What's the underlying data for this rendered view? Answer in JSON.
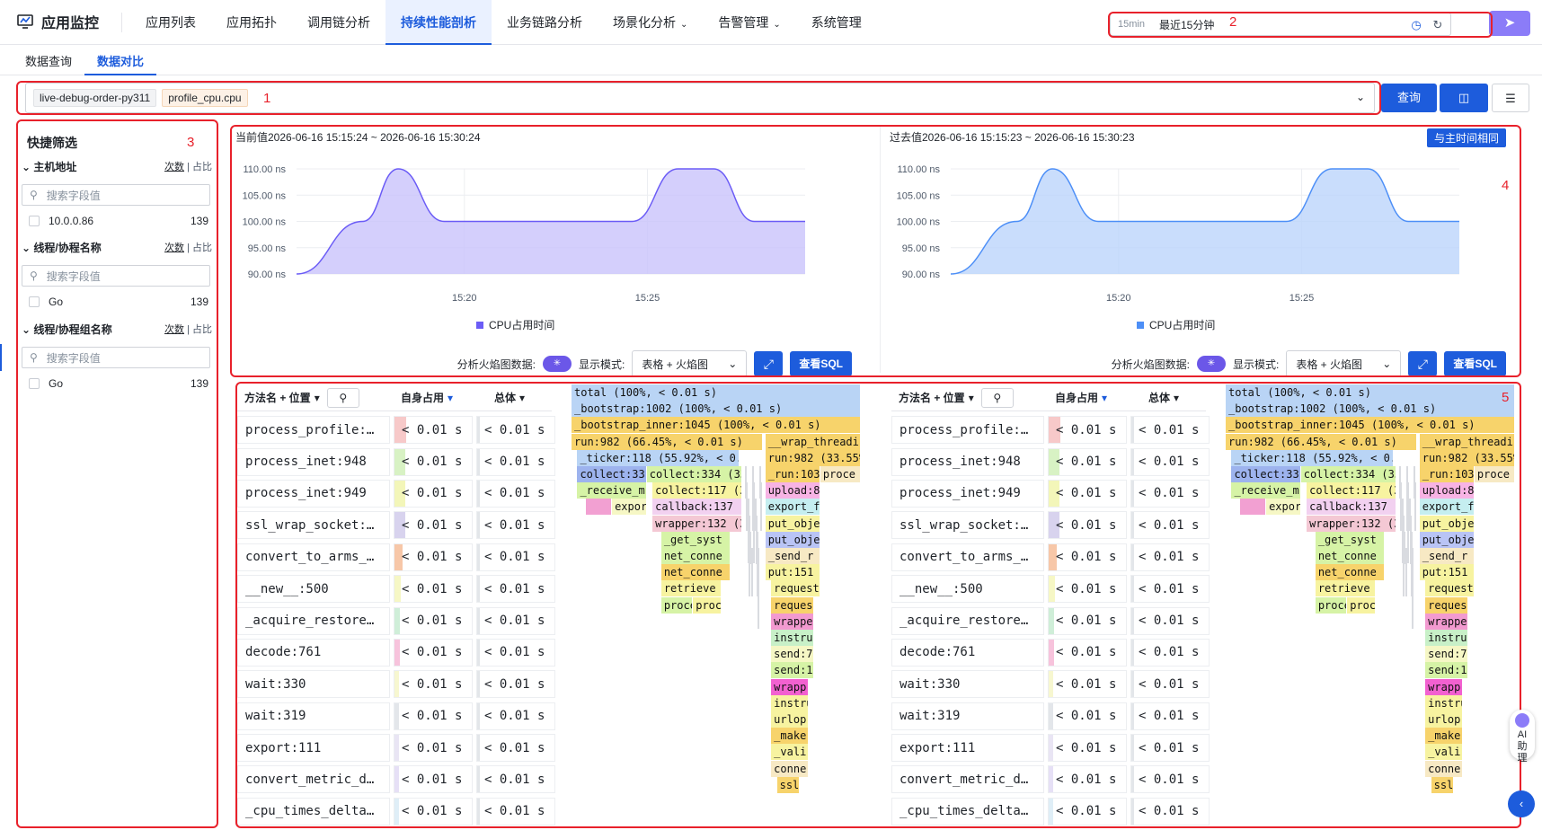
{
  "app": {
    "title": "应用监控"
  },
  "nav": {
    "tabs": [
      "应用列表",
      "应用拓扑",
      "调用链分析",
      "持续性能剖析",
      "业务链路分析",
      "场景化分析",
      "告警管理",
      "系统管理"
    ],
    "dropdown_tabs": [
      5,
      6
    ],
    "active": 3
  },
  "time": {
    "short": "15min",
    "label": "最近15分钟"
  },
  "subtabs": {
    "query": "数据查询",
    "compare": "数据对比"
  },
  "filter": {
    "tags": [
      "live-debug-order-py311",
      "profile_cpu.cpu"
    ],
    "query_button": "查询"
  },
  "annotations": [
    "1",
    "2",
    "3",
    "4",
    "5"
  ],
  "sidebar": {
    "title": "快捷筛选",
    "count_label": "次数",
    "ratio_label": "占比",
    "search_placeholder": "搜索字段值",
    "sections": [
      {
        "name": "主机地址",
        "item": "10.0.0.86",
        "count": "139"
      },
      {
        "name": "线程/协程名称",
        "item": "Go",
        "count": "139"
      },
      {
        "name": "线程/协程组名称",
        "item": "Go",
        "count": "139"
      }
    ]
  },
  "panels": [
    {
      "title": "当前值2026-06-16 15:15:24 ~ 2026-06-16 15:30:24",
      "legend": "CPU占用时间",
      "color": "#6b5cf6",
      "fill": "#c9c3fb"
    },
    {
      "title": "过去值2026-06-16 15:15:23 ~ 2026-06-16 15:30:23",
      "legend": "CPU占用时间",
      "color": "#4d8ff7",
      "fill": "#bcd5fb",
      "same_time_button": "与主时间相同"
    }
  ],
  "chart_data": {
    "type": "line",
    "ylabels": [
      "110.00 ns",
      "105.00 ns",
      "100.00 ns",
      "95.00 ns",
      "90.00 ns"
    ],
    "ylim": [
      90,
      110
    ],
    "xticks": [
      "15:20",
      "15:25"
    ],
    "series": [
      {
        "name": "CPU占用时间",
        "values": [
          90,
          100,
          110,
          100,
          100,
          100,
          100,
          110,
          110,
          100,
          100
        ]
      }
    ]
  },
  "controls": {
    "flame_label": "分析火焰图数据:",
    "mode_label": "显示模式:",
    "mode_value": "表格 + 火焰图",
    "sql_button": "查看SQL"
  },
  "table": {
    "headers": {
      "method": "方法名 + 位置",
      "self": "自身占用",
      "total": "总体"
    },
    "rows": [
      {
        "name": "process_profile:…",
        "self": "< 0.01 s",
        "total": "< 0.01 s",
        "color": "#f7c9c9",
        "w": 0.15
      },
      {
        "name": "process_inet:948",
        "self": "< 0.01 s",
        "total": "< 0.01 s",
        "color": "#d8f2c4",
        "w": 0.14
      },
      {
        "name": "process_inet:949",
        "self": "< 0.01 s",
        "total": "< 0.01 s",
        "color": "#f3f6b9",
        "w": 0.14
      },
      {
        "name": "ssl_wrap_socket:…",
        "self": "< 0.01 s",
        "total": "< 0.01 s",
        "color": "#d8d3ee",
        "w": 0.14
      },
      {
        "name": "convert_to_arms_…",
        "self": "< 0.01 s",
        "total": "< 0.01 s",
        "color": "#f7c7a8",
        "w": 0.1
      },
      {
        "name": "__new__:500",
        "self": "< 0.01 s",
        "total": "< 0.01 s",
        "color": "#f6f7c5",
        "w": 0.08
      },
      {
        "name": "_acquire_restore…",
        "self": "< 0.01 s",
        "total": "< 0.01 s",
        "color": "#cfeed8",
        "w": 0.07
      },
      {
        "name": "decode:761",
        "self": "< 0.01 s",
        "total": "< 0.01 s",
        "color": "#f7c3dc",
        "w": 0.07
      },
      {
        "name": "wait:330",
        "self": "< 0.01 s",
        "total": "< 0.01 s",
        "color": "#f7f7d0",
        "w": 0.06
      },
      {
        "name": "wait:319",
        "self": "< 0.01 s",
        "total": "< 0.01 s",
        "color": "#e3e6ea",
        "w": 0.06
      },
      {
        "name": "export:111",
        "self": "< 0.01 s",
        "total": "< 0.01 s",
        "color": "#e9e5f4",
        "w": 0.06
      },
      {
        "name": "convert_metric_d…",
        "self": "< 0.01 s",
        "total": "< 0.01 s",
        "color": "#e6e0f6",
        "w": 0.06
      },
      {
        "name": "_cpu_times_delta…",
        "self": "< 0.01 s",
        "total": "< 0.01 s",
        "color": "#dfeef7",
        "w": 0.06
      }
    ]
  },
  "flame": [
    {
      "t": "total (100%, < 0.01 s)",
      "x": 0,
      "w": 1,
      "d": 0,
      "c": "#b9d4f5"
    },
    {
      "t": "_bootstrap:1002 (100%, < 0.01 s)",
      "x": 0,
      "w": 1,
      "d": 1,
      "c": "#b9d4f5"
    },
    {
      "t": "_bootstrap_inner:1045 (100%, < 0.01 s)",
      "x": 0,
      "w": 1,
      "d": 2,
      "c": "#f7d36b"
    },
    {
      "t": "run:982 (66.45%, < 0.01 s)",
      "x": 0,
      "w": 0.66,
      "d": 3,
      "c": "#f7d36b"
    },
    {
      "t": "__wrap_threading",
      "x": 0.67,
      "w": 0.33,
      "d": 3,
      "c": "#f7d36b"
    },
    {
      "t": "_ticker:118 (55.92%, < 0.0",
      "x": 0.02,
      "w": 0.56,
      "d": 4,
      "c": "#b9d4f5"
    },
    {
      "t": "run:982 (33.55%",
      "x": 0.67,
      "w": 0.33,
      "d": 4,
      "c": "#f7d36b"
    },
    {
      "t": "collect:33",
      "x": 0.02,
      "w": 0.24,
      "d": 5,
      "c": "#9db3ee"
    },
    {
      "t": "collect:334 (33",
      "x": 0.26,
      "w": 0.33,
      "d": 5,
      "c": "#d6f3a6"
    },
    {
      "t": "_run:103",
      "x": 0.67,
      "w": 0.19,
      "d": 5,
      "c": "#f7d36b"
    },
    {
      "t": "proce",
      "x": 0.86,
      "w": 0.14,
      "d": 5,
      "c": "#f7e9c4"
    },
    {
      "t": "_receive_m",
      "x": 0.02,
      "w": 0.24,
      "d": 6,
      "c": "#d6f3a6"
    },
    {
      "t": "collect:117 (3",
      "x": 0.28,
      "w": 0.31,
      "d": 6,
      "c": "#f7f3a0"
    },
    {
      "t": "upload:8",
      "x": 0.67,
      "w": 0.19,
      "d": 6,
      "c": "#f7b3e4"
    },
    {
      "t": "",
      "x": 0.05,
      "w": 0.09,
      "d": 7,
      "c": "#f2a0d2"
    },
    {
      "t": "expor",
      "x": 0.14,
      "w": 0.12,
      "d": 7,
      "c": "#f6f7c5"
    },
    {
      "t": "callback:137 (",
      "x": 0.28,
      "w": 0.31,
      "d": 7,
      "c": "#f2d1f0"
    },
    {
      "t": "export_f",
      "x": 0.67,
      "w": 0.19,
      "d": 7,
      "c": "#c5eef0"
    },
    {
      "t": "wrapper:132 (3",
      "x": 0.28,
      "w": 0.31,
      "d": 8,
      "c": "#f4c8d4"
    },
    {
      "t": "put_obje",
      "x": 0.67,
      "w": 0.19,
      "d": 8,
      "c": "#f7f3a0"
    },
    {
      "t": "_get_syst",
      "x": 0.31,
      "w": 0.24,
      "d": 9,
      "c": "#d6f3a6"
    },
    {
      "t": "put_obje",
      "x": 0.67,
      "w": 0.19,
      "d": 9,
      "c": "#b9c4f5"
    },
    {
      "t": "net_conne",
      "x": 0.31,
      "w": 0.24,
      "d": 10,
      "c": "#d6f3a6"
    },
    {
      "t": "_send_r",
      "x": 0.67,
      "w": 0.19,
      "d": 10,
      "c": "#f7e9c4"
    },
    {
      "t": "net_conne",
      "x": 0.31,
      "w": 0.24,
      "d": 11,
      "c": "#f7d36b"
    },
    {
      "t": "put:151",
      "x": 0.67,
      "w": 0.19,
      "d": 11,
      "c": "#f7f3a0"
    },
    {
      "t": "retrieve",
      "x": 0.31,
      "w": 0.21,
      "d": 12,
      "c": "#f7f3a0"
    },
    {
      "t": "request",
      "x": 0.69,
      "w": 0.17,
      "d": 12,
      "c": "#f7f3a0"
    },
    {
      "t": "proce",
      "x": 0.31,
      "w": 0.11,
      "d": 13,
      "c": "#d6f3a6"
    },
    {
      "t": "proc",
      "x": 0.42,
      "w": 0.1,
      "d": 13,
      "c": "#f7f3a0"
    },
    {
      "t": "reques",
      "x": 0.69,
      "w": 0.15,
      "d": 13,
      "c": "#f7d36b"
    },
    {
      "t": "wrappe",
      "x": 0.69,
      "w": 0.15,
      "d": 14,
      "c": "#f29ad0"
    },
    {
      "t": "instru",
      "x": 0.69,
      "w": 0.15,
      "d": 15,
      "c": "#c8f0c8"
    },
    {
      "t": "send:7",
      "x": 0.69,
      "w": 0.15,
      "d": 16,
      "c": "#f6f7c5"
    },
    {
      "t": "send:1",
      "x": 0.69,
      "w": 0.15,
      "d": 17,
      "c": "#d6f3a6"
    },
    {
      "t": "wrapp",
      "x": 0.69,
      "w": 0.13,
      "d": 18,
      "c": "#f261d0"
    },
    {
      "t": "instru",
      "x": 0.69,
      "w": 0.13,
      "d": 19,
      "c": "#f7f3a0"
    },
    {
      "t": "urlop",
      "x": 0.69,
      "w": 0.13,
      "d": 20,
      "c": "#f7f3a0"
    },
    {
      "t": "_make",
      "x": 0.69,
      "w": 0.13,
      "d": 21,
      "c": "#f7d36b"
    },
    {
      "t": "_vali",
      "x": 0.69,
      "w": 0.13,
      "d": 22,
      "c": "#f7f3a0"
    },
    {
      "t": "conne",
      "x": 0.69,
      "w": 0.13,
      "d": 23,
      "c": "#f7e9c4"
    },
    {
      "t": "ssl",
      "x": 0.71,
      "w": 0.08,
      "d": 24,
      "c": "#f7d36b"
    }
  ],
  "floating": {
    "label": "AI助理"
  }
}
